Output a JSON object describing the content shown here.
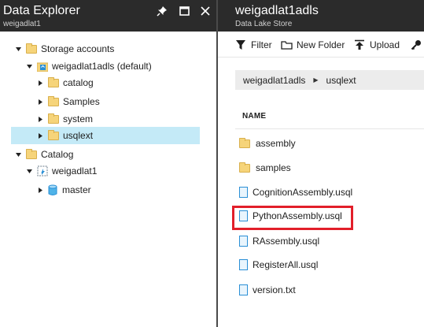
{
  "left_panel": {
    "title": "Data Explorer",
    "subtitle": "weigadlat1",
    "pin_icon": "pin-icon",
    "maximize_icon": "maximize-icon",
    "close_icon": "close-icon",
    "tree": {
      "storage_accounts": "Storage accounts",
      "account": "weigadlat1adls (default)",
      "folders": [
        "catalog",
        "Samples",
        "system",
        "usqlext"
      ],
      "catalog": "Catalog",
      "catalog_db_server": "weigadlat1",
      "database": "master"
    }
  },
  "right_panel": {
    "title": "weigadlat1adls",
    "subtitle": "Data Lake Store",
    "toolbar": {
      "filter": "Filter",
      "new_folder": "New Folder",
      "upload": "Upload"
    },
    "breadcrumb": [
      "weigadlat1adls",
      "usqlext"
    ],
    "column_header": "NAME",
    "items": [
      {
        "name": "assembly",
        "type": "folder"
      },
      {
        "name": "samples",
        "type": "folder"
      },
      {
        "name": "CognitionAssembly.usql",
        "type": "file"
      },
      {
        "name": "PythonAssembly.usql",
        "type": "file"
      },
      {
        "name": "RAssembly.usql",
        "type": "file"
      },
      {
        "name": "RegisterAll.usql",
        "type": "file"
      },
      {
        "name": "version.txt",
        "type": "file"
      }
    ]
  },
  "colors": {
    "header_bg": "#2b2b2b",
    "selected_row": "#c4eaf7",
    "highlight_border": "#e21f2a",
    "folder": "#f6d47a",
    "file_icon": "#2a8fd6"
  }
}
